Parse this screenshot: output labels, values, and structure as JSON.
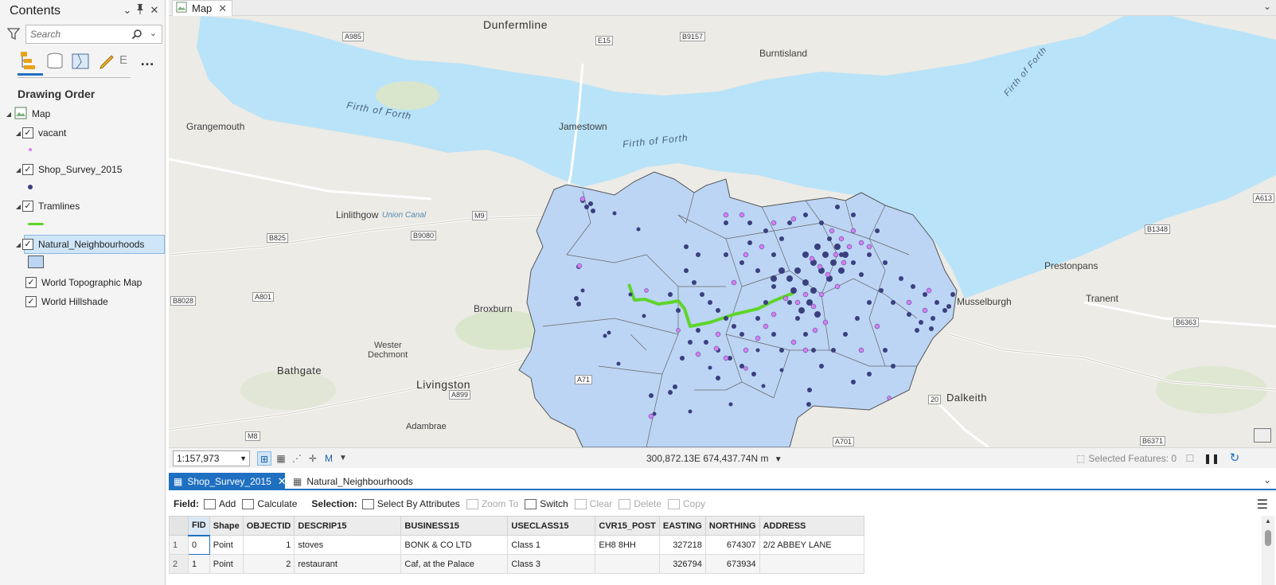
{
  "contents": {
    "title": "Contents",
    "search_placeholder": "Search",
    "drawing_order": "Drawing Order",
    "tab_partial_label": "E",
    "map_node": "Map",
    "layers": [
      {
        "name": "vacant"
      },
      {
        "name": "Shop_Survey_2015"
      },
      {
        "name": "Tramlines"
      },
      {
        "name": "Natural_Neighbourhoods"
      },
      {
        "name": "World Topographic Map"
      },
      {
        "name": "World Hillshade"
      }
    ]
  },
  "map": {
    "tab_label": "Map",
    "labels": {
      "dunfermline": "Dunfermline",
      "burntisland": "Burntisland",
      "grangemouth": "Grangemouth",
      "jamestown": "Jamestown",
      "linlithgow": "Linlithgow",
      "union_canal": "Union Canal",
      "broxburn": "Broxburn",
      "wester_dechmont_1": "Wester",
      "wester_dechmont_2": "Dechmont",
      "bathgate": "Bathgate",
      "livingston": "Livingston",
      "adambrae": "Adambrae",
      "prestonpans": "Prestonpans",
      "tranent": "Tranent",
      "musselburgh": "Musselburgh",
      "dalkeith": "Dalkeith",
      "firth1": "Firth of Forth",
      "firth2": "Firth of Forth",
      "firth3": "Firth of Forth"
    },
    "roads": {
      "a985": "A985",
      "e15": "E15",
      "b9157": "B9157",
      "m9": "M9",
      "b825": "B825",
      "b9080": "B9080",
      "a801": "A801",
      "b8028": "B8028",
      "a71": "A71",
      "a899": "A899",
      "m8": "M8",
      "a701": "A701",
      "b1348": "B1348",
      "b6363": "B6363",
      "b6371": "B6371",
      "a613": "A613",
      "r20": "20"
    }
  },
  "status": {
    "scale": "1:157,973",
    "coordinates": "300,872.13E 674,437.74N m",
    "selected_features": "Selected Features: 0"
  },
  "table": {
    "tabs": [
      "Shop_Survey_2015",
      "Natural_Neighbourhoods"
    ],
    "toolbar": {
      "field_label": "Field:",
      "add": "Add",
      "calculate": "Calculate",
      "selection_label": "Selection:",
      "select_by_attr": "Select By Attributes",
      "zoom_to": "Zoom To",
      "switch": "Switch",
      "clear": "Clear",
      "delete": "Delete",
      "copy": "Copy"
    },
    "columns": [
      "FID",
      "Shape",
      "OBJECTID",
      "DESCRIP15",
      "BUSINESS15",
      "USECLASS15",
      "CVR15_POST",
      "EASTING",
      "NORTHING",
      "ADDRESS"
    ],
    "rows": [
      {
        "rn": "1",
        "fid": "0",
        "shape": "Point",
        "objectid": "1",
        "descrip": "stoves",
        "business": "BONK & CO LTD",
        "useclass": "Class 1",
        "cvr": "EH8 8HH",
        "easting": "327218",
        "northing": "674307",
        "address": "2/2 ABBEY LANE"
      },
      {
        "rn": "2",
        "fid": "1",
        "shape": "Point",
        "objectid": "2",
        "descrip": "restaurant",
        "business": "Caf, at the Palace",
        "useclass": "Class 3",
        "cvr": "",
        "easting": "326794",
        "northing": "673934",
        "address": ""
      }
    ]
  },
  "colors": {
    "accent": "#1f70c1",
    "water": "#b9e3f8",
    "neighbourhood_fill": "#bcd5f5",
    "shop_point": "#3a3f7e",
    "vacant_point": "#d57ef0",
    "tramline": "#5fd42b"
  }
}
